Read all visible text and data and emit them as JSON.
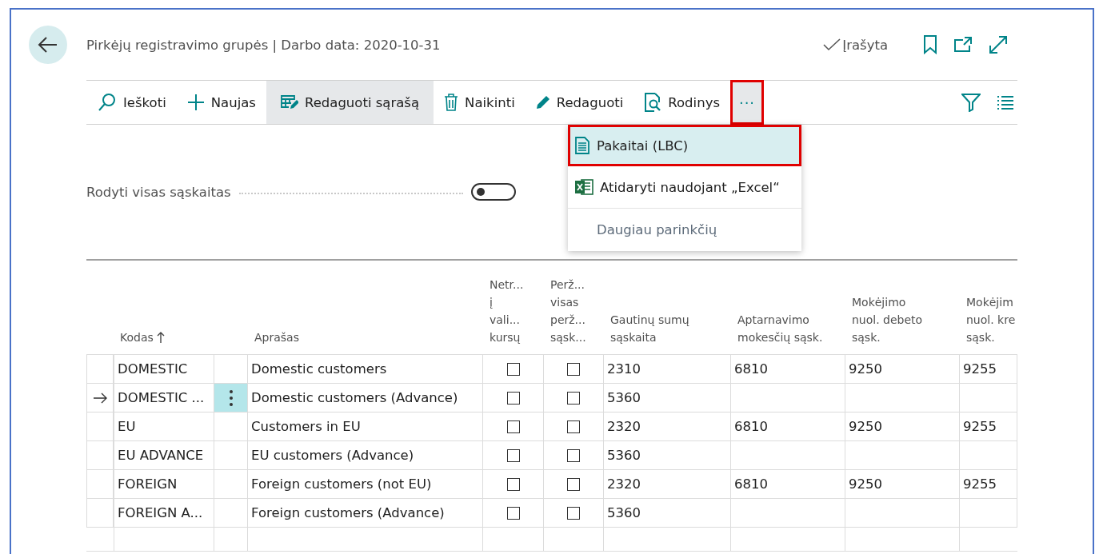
{
  "page": {
    "title": "Pirkėjų registravimo grupės | Darbo data: 2020-10-31",
    "status": "Įrašyta"
  },
  "toolbar": [
    {
      "kind": "search",
      "label": "Ieškoti",
      "active": false,
      "highlighted": false
    },
    {
      "kind": "plus",
      "label": "Naujas",
      "active": false,
      "highlighted": false
    },
    {
      "kind": "edit-list",
      "label": "Redaguoti sąrašą",
      "active": true,
      "highlighted": false
    },
    {
      "kind": "trash",
      "label": "Naikinti",
      "active": false,
      "highlighted": false
    },
    {
      "kind": "pencil",
      "label": "Redaguoti",
      "active": false,
      "highlighted": false
    },
    {
      "kind": "view",
      "label": "Rodinys",
      "active": false,
      "highlighted": false
    },
    {
      "kind": "more",
      "label": "···",
      "active": true,
      "highlighted": true
    }
  ],
  "menu": [
    {
      "kind": "document",
      "label": "Pakaitai (LBC)",
      "selected": true,
      "highlighted": true
    },
    {
      "kind": "excel",
      "label": "Atidaryti naudojant „Excel“",
      "selected": false,
      "highlighted": false
    },
    {
      "kind": "more",
      "label": "Daugiau parinkčių",
      "selected": false,
      "highlighted": false
    }
  ],
  "toggle": {
    "label": "Rodyti visas sąskaitas",
    "on": false
  },
  "table": {
    "columns": [
      {
        "label": "Kodas",
        "sorted": true
      },
      {
        "label": "Aprašas"
      },
      {
        "label": "Netr...\nį\nvali...\nkursų"
      },
      {
        "label": "Perž...\nvisas\nperž...\nsąsk..."
      },
      {
        "label": "Gautinų sumų\nsąskaita"
      },
      {
        "label": "Aptarnavimo\nmokesčių sąsk."
      },
      {
        "label": "Mokėjimo\nnuol. debeto\nsąsk."
      },
      {
        "label": "Mokėjim\nnuol. kre\nsąsk."
      }
    ],
    "rows": [
      {
        "code": "DOMESTIC",
        "description": "Domestic customers",
        "check_1": false,
        "check_2": false,
        "account_1": "2310",
        "account_2": "6810",
        "account_3": "9250",
        "account_4": "9255",
        "selected": false
      },
      {
        "code": "DOMESTIC ...",
        "description": "Domestic customers (Advance)",
        "check_1": false,
        "check_2": false,
        "account_1": "5360",
        "selected": true
      },
      {
        "code": "EU",
        "description": "Customers in EU",
        "check_1": false,
        "check_2": false,
        "account_1": "2320",
        "account_2": "6810",
        "account_3": "9250",
        "account_4": "9255",
        "selected": false
      },
      {
        "code": "EU ADVANCE",
        "description": "EU customers (Advance)",
        "check_1": false,
        "check_2": false,
        "account_1": "5360",
        "selected": false
      },
      {
        "code": "FOREIGN",
        "description": "Foreign customers (not EU)",
        "check_1": false,
        "check_2": false,
        "account_1": "2320",
        "account_2": "6810",
        "account_3": "9250",
        "account_4": "9255",
        "selected": false
      },
      {
        "code": "FOREIGN A...",
        "description": "Foreign customers (Advance)",
        "check_1": false,
        "check_2": false,
        "account_1": "5360",
        "selected": false
      }
    ]
  }
}
